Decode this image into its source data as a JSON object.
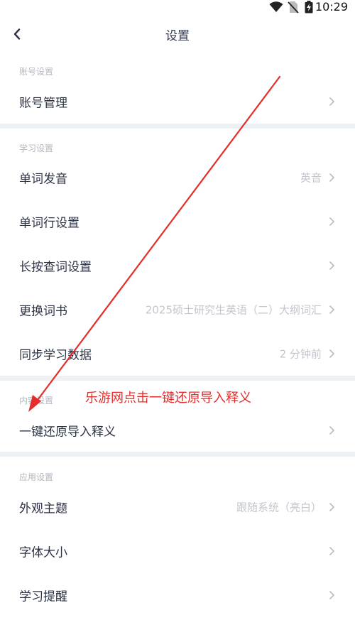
{
  "status_bar": {
    "time": "10:29",
    "icons": [
      "wifi-icon",
      "no-sim-icon",
      "battery-charging-icon"
    ]
  },
  "header": {
    "title": "设置",
    "back_icon": "chevron-left-icon"
  },
  "sections": {
    "account": {
      "label": "账号设置",
      "items": [
        {
          "label": "账号管理",
          "value": ""
        }
      ]
    },
    "study": {
      "label": "学习设置",
      "items": [
        {
          "label": "单词发音",
          "value": "英音"
        },
        {
          "label": "单词行设置",
          "value": ""
        },
        {
          "label": "长按查词设置",
          "value": ""
        },
        {
          "label": "更换词书",
          "value": "2025硕士研究生英语（二）大纲词汇"
        },
        {
          "label": "同步学习数据",
          "value": "2 分钟前"
        }
      ]
    },
    "content": {
      "label": "内容设置",
      "items": [
        {
          "label": "一键还原导入释义",
          "value": ""
        }
      ]
    },
    "app": {
      "label": "应用设置",
      "items": [
        {
          "label": "外观主题",
          "value": "跟随系统（亮白）"
        },
        {
          "label": "字体大小",
          "value": ""
        },
        {
          "label": "学习提醒",
          "value": ""
        }
      ]
    }
  },
  "annotation": {
    "text": "乐游网点击一键还原导入释义",
    "color": "#e52d2d"
  },
  "colors": {
    "text_primary": "#2c3345",
    "text_secondary": "#c3c6cc",
    "section_label": "#b3b7bf",
    "divider": "#eef1f4",
    "annotation_red": "#e52d2d"
  }
}
